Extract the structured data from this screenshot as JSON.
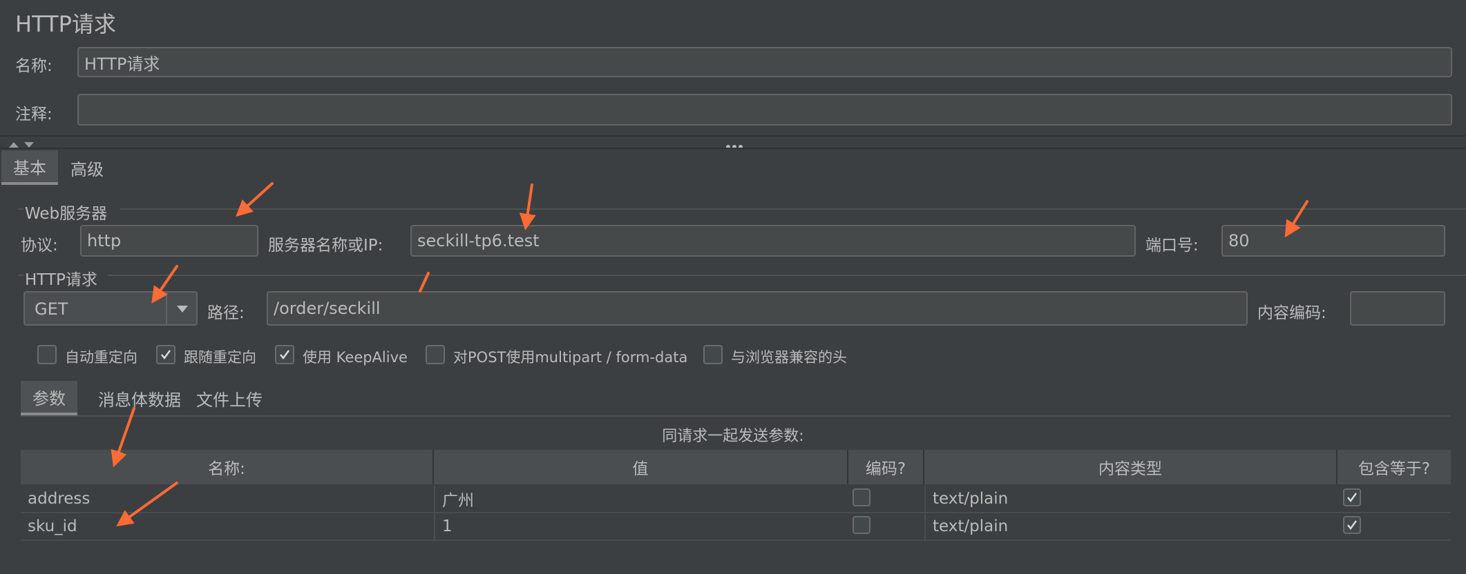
{
  "header": {
    "title": "HTTP请求"
  },
  "form": {
    "name_label": "名称:",
    "name_value": "HTTP请求",
    "comment_label": "注释:",
    "comment_value": ""
  },
  "main_tabs": [
    {
      "label": "基本",
      "active": true
    },
    {
      "label": "高级",
      "active": false
    }
  ],
  "web_server": {
    "section_title": "Web服务器",
    "protocol_label": "协议:",
    "protocol_value": "http",
    "server_label": "服务器名称或IP:",
    "server_value": "seckill-tp6.test",
    "port_label": "端口号:",
    "port_value": "80"
  },
  "http_request": {
    "section_title": "HTTP请求",
    "method_value": "GET",
    "path_label": "路径:",
    "path_value": "/order/seckill",
    "encoding_label": "内容编码:",
    "encoding_value": ""
  },
  "options": [
    {
      "label": "自动重定向",
      "checked": false
    },
    {
      "label": "跟随重定向",
      "checked": true
    },
    {
      "label": "使用 KeepAlive",
      "checked": true
    },
    {
      "label": "对POST使用multipart / form-data",
      "checked": false
    },
    {
      "label": "与浏览器兼容的头",
      "checked": false
    }
  ],
  "sub_tabs": [
    {
      "label": "参数",
      "active": true
    },
    {
      "label": "消息体数据",
      "active": false
    },
    {
      "label": "文件上传",
      "active": false
    }
  ],
  "params": {
    "caption": "同请求一起发送参数:",
    "columns": [
      "名称:",
      "值",
      "编码?",
      "内容类型",
      "包含等于?"
    ],
    "rows": [
      {
        "name": "address",
        "value": "广州",
        "encode": false,
        "content_type": "text/plain",
        "include_equals": true
      },
      {
        "name": "sku_id",
        "value": "1",
        "encode": false,
        "content_type": "text/plain",
        "include_equals": true
      }
    ]
  },
  "colors": {
    "background": "#3c3f41",
    "field_bg": "#45494a",
    "annotation_arrow": "#ff6b35"
  }
}
